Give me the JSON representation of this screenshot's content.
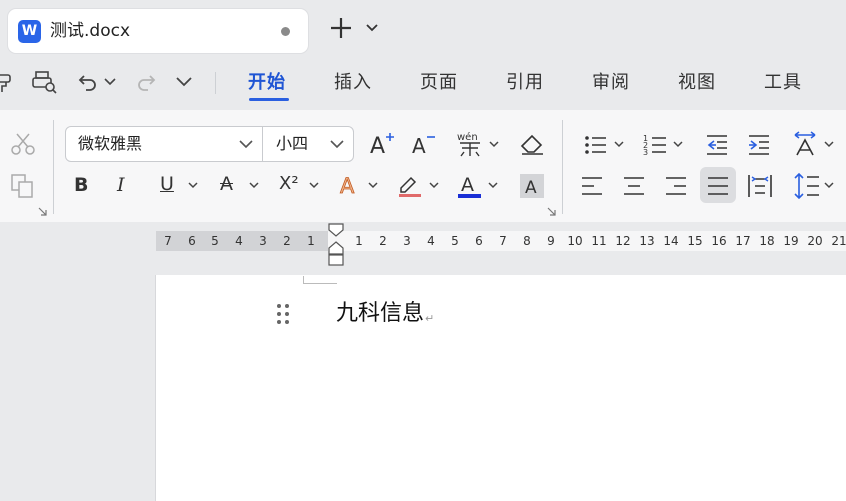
{
  "window": {
    "tab_title": "测试.docx",
    "app_logo": "W"
  },
  "quick_access": {
    "icons": [
      "format-painter-icon",
      "print-preview-icon",
      "undo-icon",
      "redo-icon",
      "more-chevron-icon"
    ]
  },
  "menu": {
    "tabs": [
      {
        "label": "开始",
        "active": true
      },
      {
        "label": "插入"
      },
      {
        "label": "页面"
      },
      {
        "label": "引用"
      },
      {
        "label": "审阅"
      },
      {
        "label": "视图"
      },
      {
        "label": "工具"
      }
    ]
  },
  "ribbon": {
    "font_name": "微软雅黑",
    "font_size": "小四",
    "pinyin_label": "wén",
    "bold_label": "B",
    "italic_label": "I",
    "underline_label": "U",
    "strike_label": "A",
    "superscript_label": "X²",
    "font_color_label": "A",
    "shade_label": "A",
    "grow_label": "A",
    "shrink_label": "A",
    "text_effect_label": "A",
    "font_color_hex": "#1a2fd6",
    "highlight_hex": "#e06a6a"
  },
  "ruler": {
    "left_numbers": [
      "7",
      "6",
      "5",
      "4",
      "3",
      "2",
      "1"
    ],
    "right_numbers": [
      "1",
      "2",
      "3",
      "4",
      "5",
      "6",
      "7",
      "8",
      "9",
      "10",
      "11",
      "12",
      "13",
      "14",
      "15",
      "16",
      "17",
      "18",
      "19",
      "20",
      "21"
    ]
  },
  "document": {
    "paragraph_text": "九科信息",
    "paragraph_mark": "↵"
  },
  "colors": {
    "accent": "#2a5fe0",
    "logo_bg": "#2a65e8"
  }
}
